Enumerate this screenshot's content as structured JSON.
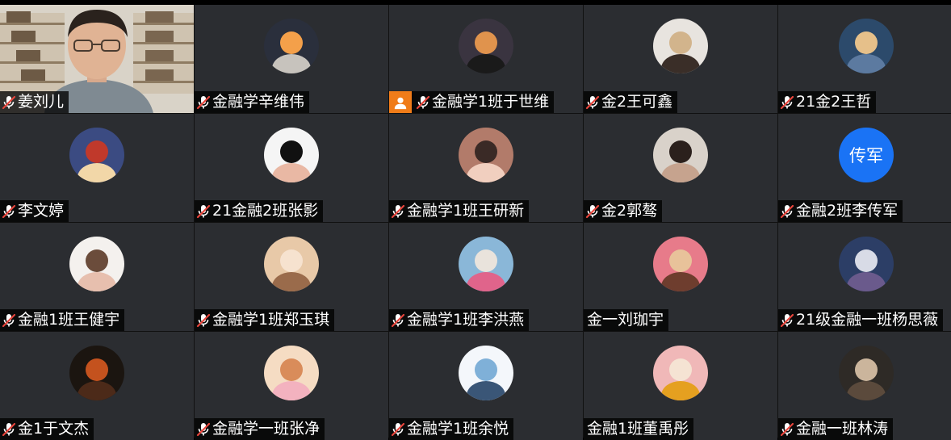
{
  "participants": [
    {
      "name": "姜刘儿",
      "muted": true,
      "video": true
    },
    {
      "name": "金融学辛维伟",
      "muted": true,
      "palette": [
        "#2a2f3c",
        "#f4a04a",
        "#c7c3bd"
      ]
    },
    {
      "name": "金融学1班于世维",
      "muted": true,
      "host_badge": true,
      "palette": [
        "#3a3440",
        "#e0934d",
        "#1a1a1a"
      ]
    },
    {
      "name": "金2王可鑫",
      "muted": true,
      "palette": [
        "#e8e4df",
        "#d2b48c",
        "#3a2e28"
      ]
    },
    {
      "name": "21金2王哲",
      "muted": true,
      "palette": [
        "#2c4a6b",
        "#e6c08a",
        "#5c7aa0"
      ]
    },
    {
      "name": "李文婷",
      "muted": true,
      "palette": [
        "#3b4b82",
        "#c0392b",
        "#f2d7a8"
      ]
    },
    {
      "name": "21金融2班张影",
      "muted": true,
      "palette": [
        "#f5f5f5",
        "#111111",
        "#e9b8a4"
      ]
    },
    {
      "name": "金融学1班王研新",
      "muted": true,
      "palette": [
        "#b27b6a",
        "#3a2a26",
        "#f1cfbf"
      ]
    },
    {
      "name": "金2郭骜",
      "muted": true,
      "palette": [
        "#d9d2ca",
        "#2b201c",
        "#c6a38e"
      ]
    },
    {
      "name": "金融2班李传军",
      "muted": true,
      "text_avatar": "传军",
      "avatar_color": "#1a73f5"
    },
    {
      "name": "金融1班王健宇",
      "muted": true,
      "palette": [
        "#f4f1ee",
        "#6b4c3b",
        "#e7bfae"
      ]
    },
    {
      "name": "金融学1班郑玉琪",
      "muted": true,
      "palette": [
        "#e8c9a8",
        "#f6e2cf",
        "#9a6b4b"
      ]
    },
    {
      "name": "金融学1班李洪燕",
      "muted": true,
      "palette": [
        "#8ab7d8",
        "#e9e3dc",
        "#e0648b"
      ]
    },
    {
      "name": "金一刘珈宇",
      "muted": false,
      "palette": [
        "#e77b8a",
        "#e8c29a",
        "#6e3d2e"
      ]
    },
    {
      "name": "21级金融一班杨思薇",
      "muted": true,
      "palette": [
        "#2c3e66",
        "#d8dbe6",
        "#6a5a8c"
      ]
    },
    {
      "name": "金1于文杰",
      "muted": true,
      "palette": [
        "#1b1510",
        "#c4521e",
        "#4c2a19"
      ]
    },
    {
      "name": "金融学一班张净",
      "muted": true,
      "palette": [
        "#f5dcc3",
        "#d98c5a",
        "#f3b2bf"
      ]
    },
    {
      "name": "金融学1班余悦",
      "muted": true,
      "palette": [
        "#f4f7fb",
        "#7fb0d8",
        "#3a5677"
      ]
    },
    {
      "name": "金融1班董禹彤",
      "muted": false,
      "palette": [
        "#f0b8b8",
        "#f5e3d3",
        "#e5a020"
      ]
    },
    {
      "name": "金融一班林涛",
      "muted": true,
      "palette": [
        "#2e2a26",
        "#cbb59c",
        "#5b4a3c"
      ]
    }
  ]
}
